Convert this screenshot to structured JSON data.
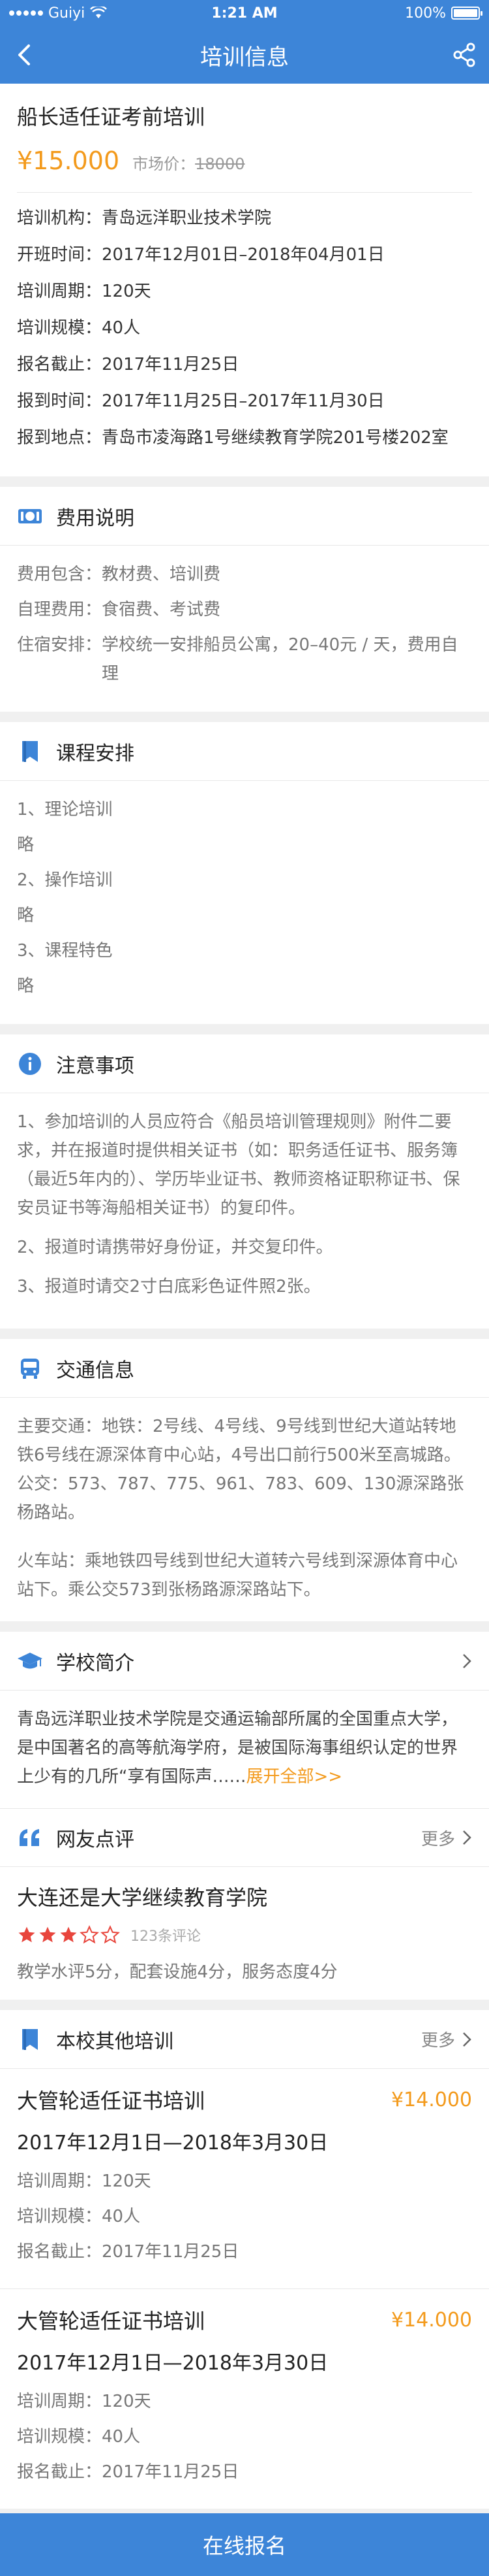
{
  "statusbar": {
    "carrier": "Guiyi",
    "time": "1:21 AM",
    "battery": "100%"
  },
  "nav": {
    "title": "培训信息",
    "back_icon": "back-chevron-icon",
    "share_icon": "share-icon"
  },
  "course": {
    "title": "船长适任证考前培训",
    "price": "¥15.000",
    "market_label": "市场价：",
    "market_price": "18000",
    "info": [
      {
        "label": "培训机构：",
        "value": "青岛远洋职业技术学院"
      },
      {
        "label": "开班时间：",
        "value": "2017年12月01日–2018年04月01日"
      },
      {
        "label": "培训周期：",
        "value": "120天"
      },
      {
        "label": "培训规模：",
        "value": "40人"
      },
      {
        "label": "报名截止：",
        "value": "2017年11月25日"
      },
      {
        "label": "报到时间：",
        "value": "2017年11月25日–2017年11月30日"
      },
      {
        "label": "报到地点：",
        "value": "青岛市凌海路1号继续教育学院201号楼202室"
      }
    ]
  },
  "fees": {
    "heading": "费用说明",
    "rows": [
      {
        "label": "费用包含：",
        "value": "教材费、培训费"
      },
      {
        "label": "自理费用：",
        "value": "食宿费、考试费"
      },
      {
        "label": "住宿安排：",
        "value": "学校统一安排船员公寓，20–40元 / 天，费用自理"
      }
    ]
  },
  "schedule": {
    "heading": "课程安排",
    "lines": [
      "1、理论培训",
      "略",
      "2、操作培训",
      "略",
      "3、课程特色",
      "略"
    ]
  },
  "notice": {
    "heading": "注意事项",
    "items": [
      "1、参加培训的人员应符合《船员培训管理规则》附件二要求，并在报道时提供相关证书（如：职务适任证书、服务簿（最近5年内的）、学历毕业证书、教师资格证职称证书、保安员证书等海船相关证书）的复印件。",
      "2、报道时请携带好身份证，并交复印件。",
      "3、报道时请交2寸白底彩色证件照2张。"
    ]
  },
  "traffic": {
    "heading": "交通信息",
    "paragraphs": [
      "主要交通：地铁：2号线、4号线、9号线到世纪大道站转地铁6号线在源深体育中心站，4号出口前行500米至高城路。公交：573、787、775、961、783、609、130源深路张杨路站。",
      "火车站：乘地铁四号线到世纪大道转六号线到深源体育中心站下。乘公交573到张杨路源深路站下。"
    ]
  },
  "school": {
    "heading": "学校简介",
    "text": "青岛远洋职业技术学院是交通运输部所属的全国重点大学，是中国著名的高等航海学府，是被国际海事组织认定的世界上少有的几所“享有国际声……",
    "expand": "展开全部>>"
  },
  "reviews": {
    "heading": "网友点评",
    "more": "更多",
    "school_name": "大连还是大学继续教育学院",
    "rating": 3,
    "rating_max": 5,
    "count": "123条评论",
    "scores": "教学水评5分，配套设施4分，服务态度4分"
  },
  "other": {
    "heading": "本校其他培训",
    "more": "更多",
    "items": [
      {
        "title": "大管轮适任证书培训",
        "price": "¥14.000",
        "dates": "2017年12月1日—2018年3月30日",
        "period": "培训周期：120天",
        "scale": "培训规模：40人",
        "deadline": "报名截止：2017年11月25日"
      },
      {
        "title": "大管轮适任证书培训",
        "price": "¥14.000",
        "dates": "2017年12月1日—2018年3月30日",
        "period": "培训周期：120天",
        "scale": "培训规模：40人",
        "deadline": "报名截止：2017年11月25日"
      }
    ]
  },
  "cta": {
    "label": "在线报名"
  },
  "colors": {
    "primary": "#3d85d8",
    "accent": "#f39a1c",
    "star": "#e8453c"
  }
}
